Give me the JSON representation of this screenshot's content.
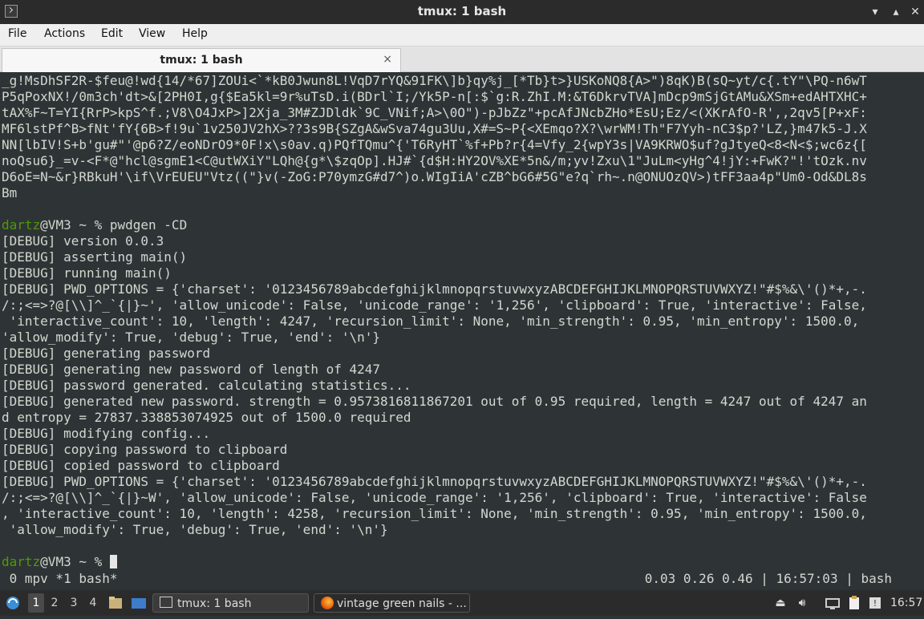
{
  "window": {
    "title": "tmux: 1 bash",
    "icons": [
      "terminal-icon",
      "minimize-icon",
      "maximize-icon",
      "close-icon"
    ]
  },
  "menu": {
    "items": [
      "File",
      "Actions",
      "Edit",
      "View",
      "Help"
    ]
  },
  "tab": {
    "label": "tmux: 1 bash",
    "close": "×"
  },
  "terminal": {
    "lines": [
      {
        "text": "_g!MsDhSF2R-$feu@!wd{14/*67]ZOUi<`*kB0Jwun8L!VqD7rYQ&91FK\\]b}qy%j_[*Tb}t>}USKoNQ8{A>\")8qK)B(sQ~yt/c{.tY\"\\PQ-n6wT"
      },
      {
        "text": "P5qPoxNX!/0m3ch'dt>&[2PH0I,g{$Ea5kl=9r%uTsD.i(BDrl`I;/Yk5P-n[:$`g:R.ZhI.M:&T6DkrvTVA]mDcp9mSjGtAMu&XSm+edAHTXHC+"
      },
      {
        "text": "tAX%F~T=YI{RrP>kpS^f.;V8\\O4JxP>]2Xja_3M#ZJDldk`9C_VNif;A>\\0O\")-pJbZz\"+pcAfJNcbZHo*EsU;Ez/<(XKrAfO-R',,2qv5[P+xF:"
      },
      {
        "text": "MF6lstPf^B>fNt'fY{6B>f!9u`1v250JV2hX>??3s9B{SZgA&wSva74gu3Uu,X#=S~P{<XEmqo?X?\\wrWM!Th\"F7Yyh-nC3$p?'LZ,}m47k5-J.X"
      },
      {
        "text": "NN[lbIV!S+b'gu#\"'@p6?Z/eoNDrO9*0F!x\\s0av.q)PQfTQmu^{'T6RyHT`%f+Pb?r{4=Vfy_2{wpY3s|VA9KRWO$uf?gJtyeQ<8<N<$;wc6z{["
      },
      {
        "text": "noQsu6}_=v-<F*@\"hcl@sgmE1<C@utWXiY\"LQh@{g*\\$zqOp].HJ#`{d$H:HY2OV%XE*5n&/m;yv!Zxu\\1\"JuLm<yHg^4!jY:+FwK?\"!'tOzk.nv"
      },
      {
        "text": "D6oE=N~&r}RBkuH'\\if\\VrEUEU\"Vtz((\"}v(-ZoG:P70ymzG#d7^)o.WIgIiA'cZB^bG6#5G\"e?q`rh~.n@ONUOzQV>)tFF3aa4p\"Um0-Od&DL8s"
      },
      {
        "text": "Bm"
      },
      {
        "text": ""
      },
      {
        "user": "dartz",
        "host_text": "@VM3 ~ % pwdgen -CD"
      },
      {
        "text": "[DEBUG] version 0.0.3"
      },
      {
        "text": "[DEBUG] asserting main()"
      },
      {
        "text": "[DEBUG] running main()"
      },
      {
        "text": "[DEBUG] PWD_OPTIONS = {'charset': '0123456789abcdefghijklmnopqrstuvwxyzABCDEFGHIJKLMNOPQRSTUVWXYZ!\"#$%&\\'()*+,-."
      },
      {
        "text": "/:;<=>?@[\\\\]^_`{|}~', 'allow_unicode': False, 'unicode_range': '1,256', 'clipboard': True, 'interactive': False,"
      },
      {
        "text": " 'interactive_count': 10, 'length': 4247, 'recursion_limit': None, 'min_strength': 0.95, 'min_entropy': 1500.0,"
      },
      {
        "text": "'allow_modify': True, 'debug': True, 'end': '\\n'}"
      },
      {
        "text": "[DEBUG] generating password"
      },
      {
        "text": "[DEBUG] generating new password of length of 4247"
      },
      {
        "text": "[DEBUG] password generated. calculating statistics..."
      },
      {
        "text": "[DEBUG] generated new password. strength = 0.9573816811867201 out of 0.95 required, length = 4247 out of 4247 an"
      },
      {
        "text": "d entropy = 27837.338853074925 out of 1500.0 required"
      },
      {
        "text": "[DEBUG] modifying config..."
      },
      {
        "text": "[DEBUG] copying password to clipboard"
      },
      {
        "text": "[DEBUG] copied password to clipboard"
      },
      {
        "text": "[DEBUG] PWD_OPTIONS = {'charset': '0123456789abcdefghijklmnopqrstuvwxyzABCDEFGHIJKLMNOPQRSTUVWXYZ!\"#$%&\\'()*+,-."
      },
      {
        "text": "/:;<=>?@[\\\\]^_`{|}~W', 'allow_unicode': False, 'unicode_range': '1,256', 'clipboard': True, 'interactive': False"
      },
      {
        "text": ", 'interactive_count': 10, 'length': 4258, 'recursion_limit': None, 'min_strength': 0.95, 'min_entropy': 1500.0,"
      },
      {
        "text": " 'allow_modify': True, 'debug': True, 'end': '\\n'}"
      },
      {
        "text": ""
      },
      {
        "user": "dartz",
        "host_text": "@VM3 ~ % ",
        "cursor": true
      }
    ]
  },
  "tmux_status": {
    "left": " 0 mpv *1 bash*",
    "right": "0.03 0.26 0.46 | 16:57:03 | bash"
  },
  "taskbar": {
    "workspaces": [
      "1",
      "2",
      "3",
      "4"
    ],
    "active_workspace": "1",
    "tasks": [
      {
        "label": "tmux: 1 bash",
        "icon": "terminal-icon"
      },
      {
        "label": "vintage green nails - ...",
        "icon": "firefox-icon"
      }
    ],
    "clock": "16:57",
    "icons": [
      "start-menu-icon",
      "file-manager-icon",
      "show-desktop-icon",
      "eject-icon",
      "volume-icon",
      "network-icon",
      "clipboard-icon",
      "notifications-icon"
    ]
  }
}
